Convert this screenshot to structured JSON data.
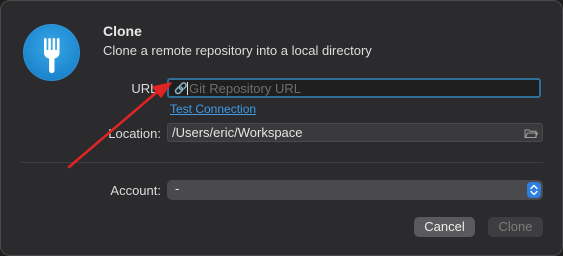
{
  "dialog": {
    "title": "Clone",
    "subtitle": "Clone a remote repository into a local directory"
  },
  "app_icon": {
    "name": "fork-icon",
    "color": "#1f8ad2"
  },
  "url": {
    "label": "URL:",
    "placeholder": "Git Repository URL",
    "value": "",
    "icon": "link-icon",
    "test_connection_label": "Test Connection"
  },
  "location": {
    "label": "Location:",
    "value": "/Users/eric/Workspace",
    "icon": "folder-icon"
  },
  "account": {
    "label": "Account:",
    "selected": "-",
    "icon": "up-down-chevron-icon"
  },
  "buttons": {
    "cancel_label": "Cancel",
    "clone_label": "Clone"
  },
  "annotation": {
    "type": "arrow",
    "color": "#e02424"
  },
  "colors": {
    "accent": "#2f7fe0",
    "link": "#3f9be8",
    "focus_ring": "#2f6f98"
  }
}
